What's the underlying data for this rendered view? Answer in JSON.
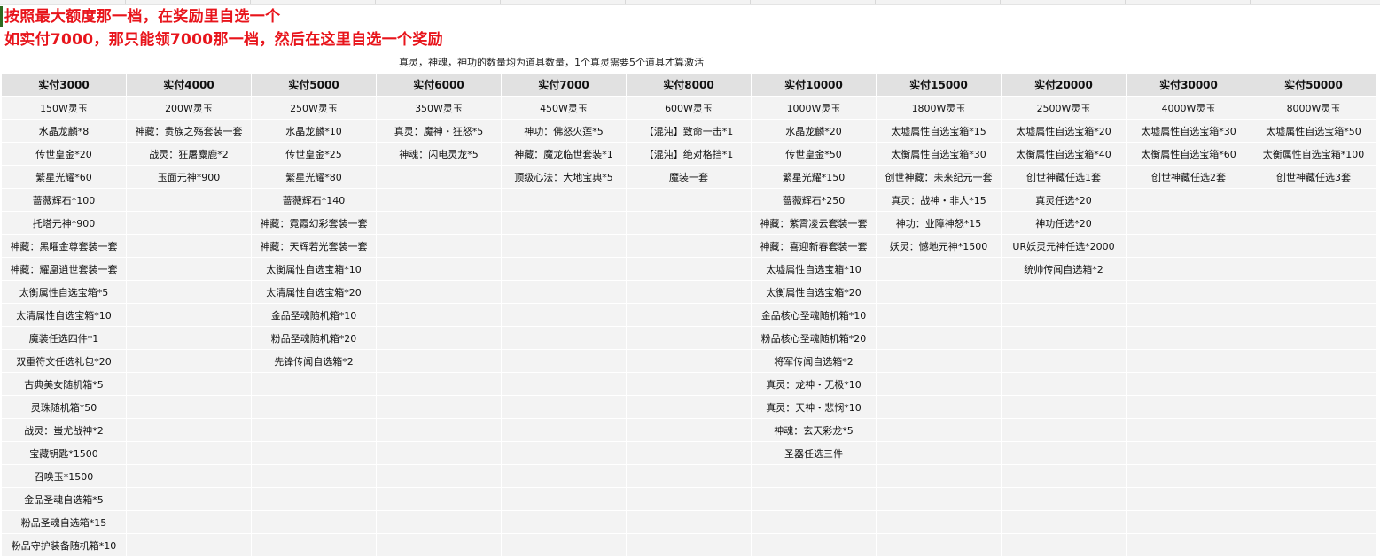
{
  "headline_1": "按照最大额度那一档，在奖励里自选一个",
  "headline_2": "如实付7000，那只能领7000那一档，然后在这里自选一个奖励",
  "note": "真灵，神魂，神功的数量均为道具数量，1个真灵需要5个道具才算激活",
  "columns": [
    {
      "header": "实付3000",
      "items": [
        "150W灵玉",
        "水晶龙麟*8",
        "传世皇金*20",
        "繁星光耀*60",
        "蔷薇辉石*100",
        "托塔元神*900",
        "神藏：黑曜金尊套装一套",
        "神藏：耀凰逍世套装一套",
        "太衡属性自选宝箱*5",
        "太清属性自选宝箱*10",
        "魔装任选四件*1",
        "双重符文任选礼包*20",
        "古典美女随机箱*5",
        "灵珠随机箱*50",
        "战灵：蚩尤战神*2",
        "宝藏钥匙*1500",
        "召唤玉*1500",
        "金品圣魂自选箱*5",
        "粉品圣魂自选箱*15",
        "粉品守护装备随机箱*10"
      ]
    },
    {
      "header": "实付4000",
      "items": [
        "200W灵玉",
        "神藏：贵族之殇套装一套",
        "战灵：狂屠麋鹿*2",
        "玉面元神*900"
      ]
    },
    {
      "header": "实付5000",
      "items": [
        "250W灵玉",
        "水晶龙麟*10",
        "传世皇金*25",
        "繁星光耀*80",
        "蔷薇辉石*140",
        "神藏：霓霞幻彩套装一套",
        "神藏：天辉若光套装一套",
        "太衡属性自选宝箱*10",
        "太清属性自选宝箱*20",
        "金品圣魂随机箱*10",
        "粉品圣魂随机箱*20",
        "先锋传闻自选箱*2"
      ]
    },
    {
      "header": "实付6000",
      "items": [
        "350W灵玉",
        "真灵：魔神・狂怒*5",
        "神魂：闪电灵龙*5"
      ]
    },
    {
      "header": "实付7000",
      "items": [
        "450W灵玉",
        "神功：佛怒火莲*5",
        "神藏：魔龙临世套装*1",
        "顶级心法：大地宝典*5"
      ]
    },
    {
      "header": "实付8000",
      "items": [
        "600W灵玉",
        "【混沌】致命一击*1",
        "【混沌】绝对格挡*1",
        "魔装一套"
      ]
    },
    {
      "header": "实付10000",
      "items": [
        "1000W灵玉",
        "水晶龙麟*20",
        "传世皇金*50",
        "繁星光耀*150",
        "蔷薇辉石*250",
        "神藏：紫霄凌云套装一套",
        "神藏：喜迎新春套装一套",
        "太墟属性自选宝箱*10",
        "太衡属性自选宝箱*20",
        "金品核心圣魂随机箱*10",
        "粉品核心圣魂随机箱*20",
        "将军传闻自选箱*2",
        "真灵：龙神・无极*10",
        "真灵：天神・悲悯*10",
        "神魂：玄天彩龙*5",
        "圣器任选三件"
      ]
    },
    {
      "header": "实付15000",
      "items": [
        "1800W灵玉",
        "太墟属性自选宝箱*15",
        "太衡属性自选宝箱*30",
        "创世神藏：未来纪元一套",
        "真灵：战神・非人*15",
        "神功：业障神怒*15",
        "妖灵：憾地元神*1500"
      ]
    },
    {
      "header": "实付20000",
      "items": [
        "2500W灵玉",
        "太墟属性自选宝箱*20",
        "太衡属性自选宝箱*40",
        "创世神藏任选1套",
        "真灵任选*20",
        "神功任选*20",
        "UR妖灵元神任选*2000",
        "统帅传闻自选箱*2"
      ]
    },
    {
      "header": "实付30000",
      "items": [
        "4000W灵玉",
        "太墟属性自选宝箱*30",
        "太衡属性自选宝箱*60",
        "创世神藏任选2套"
      ]
    },
    {
      "header": "实付50000",
      "items": [
        "8000W灵玉",
        "太墟属性自选宝箱*50",
        "太衡属性自选宝箱*100",
        "创世神藏任选3套"
      ]
    }
  ]
}
